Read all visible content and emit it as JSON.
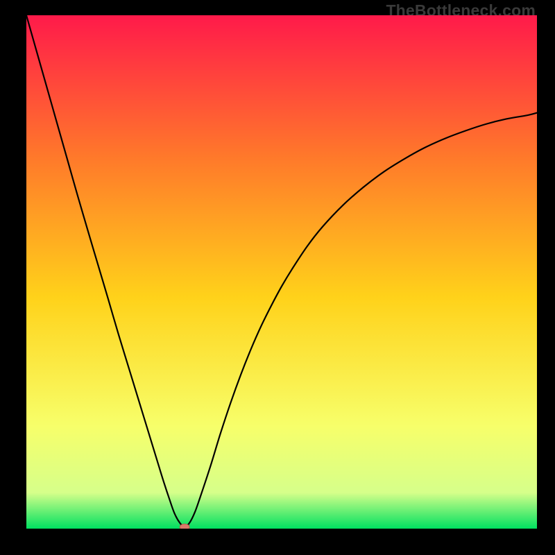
{
  "watermark": "TheBottleneck.com",
  "colors": {
    "frame": "#000000",
    "grad_top": "#ff1a4a",
    "grad_upper_mid": "#ff7a2a",
    "grad_mid": "#ffd21a",
    "grad_lower_mid": "#f7ff6a",
    "grad_near_bottom": "#d6ff8a",
    "grad_bottom": "#00e060",
    "curve": "#000000",
    "marker_fill": "#d97a6a",
    "marker_stroke": "#b85a4a"
  },
  "chart_data": {
    "type": "line",
    "title": "",
    "xlabel": "",
    "ylabel": "",
    "xlim": [
      0,
      100
    ],
    "ylim": [
      0,
      100
    ],
    "grid": false,
    "legend": false,
    "x": [
      0,
      2,
      4,
      6,
      8,
      10,
      12,
      14,
      16,
      18,
      20,
      22,
      24,
      26,
      27,
      28,
      29,
      30,
      31,
      32,
      33,
      34,
      36,
      38,
      40,
      42,
      44,
      46,
      48,
      50,
      52,
      55,
      58,
      62,
      66,
      70,
      74,
      78,
      82,
      86,
      90,
      94,
      98,
      100
    ],
    "values": [
      100,
      93,
      86,
      79,
      72,
      65,
      58.2,
      51.5,
      44.8,
      38,
      31.5,
      25,
      18.5,
      12,
      8.8,
      5.8,
      3,
      1.2,
      0.3,
      1.2,
      3.2,
      6,
      12,
      18.5,
      24.5,
      30,
      35,
      39.5,
      43.5,
      47.2,
      50.5,
      55,
      58.8,
      63,
      66.5,
      69.5,
      72,
      74.2,
      76,
      77.5,
      78.8,
      79.8,
      80.5,
      81
    ],
    "marker": {
      "x": 31,
      "y": 0.3
    },
    "notes": "V-shaped bottleneck curve; minimum near x≈31, right side asymptotes near y≈81."
  }
}
